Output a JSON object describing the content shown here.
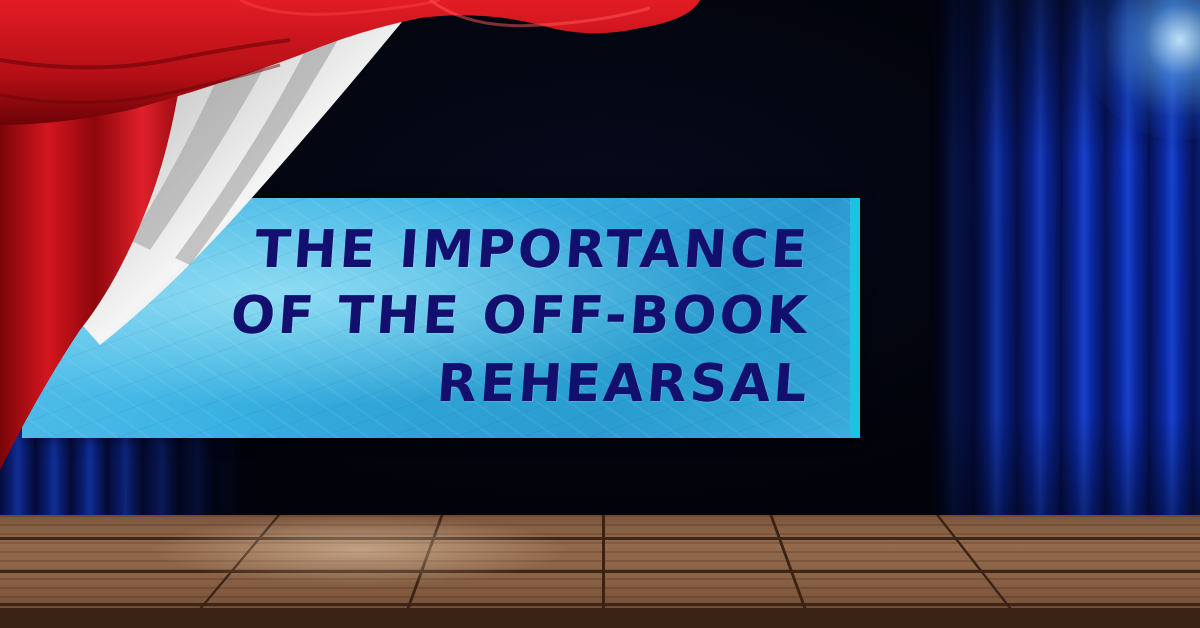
{
  "banner": {
    "title_lines": [
      "THE IMPORTANCE",
      "OF THE OFF-BOOK",
      "REHEARSAL"
    ]
  },
  "colors": {
    "title_text": "#120f6e",
    "banner_blue": "#3ab3e4",
    "banner_edge": "#1cc3e0",
    "red_curtain": "#c0121a",
    "blue_curtain": "#0b2aa8",
    "stage_wood": "#8a6245"
  }
}
